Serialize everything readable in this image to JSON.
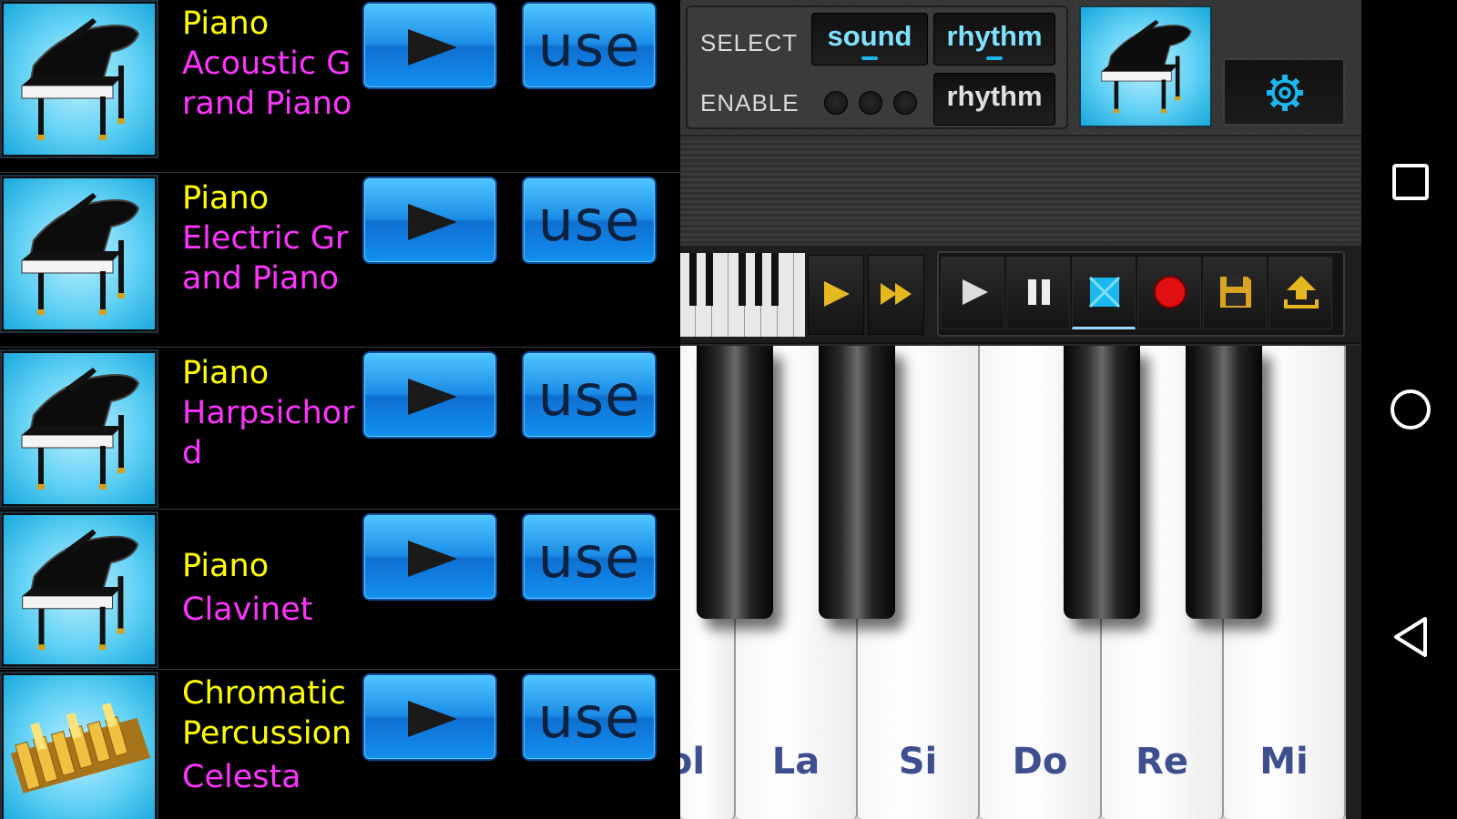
{
  "instrument_list": [
    {
      "category": "Piano",
      "name": "Acoustic Grand Piano",
      "thumb": "grand-piano",
      "use_label": "use"
    },
    {
      "category": "Piano",
      "name": "Electric Grand Piano",
      "thumb": "grand-piano",
      "use_label": "use"
    },
    {
      "category": "Piano",
      "name": "Harpsichord",
      "thumb": "grand-piano",
      "use_label": "use"
    },
    {
      "category": "Piano",
      "name": "Clavinet",
      "thumb": "grand-piano",
      "use_label": "use"
    },
    {
      "category": "Chromatic Percussion",
      "name": "Celesta",
      "thumb": "glockenspiel",
      "use_label": "use"
    }
  ],
  "controls": {
    "select_label": "SELECT",
    "enable_label": "ENABLE",
    "sound_tab": "sound",
    "rhythm_tab": "rhythm",
    "rhythm_enable": "rhythm",
    "settings_icon": "gear-icon"
  },
  "transport": {
    "buttons": [
      "play-next-icon",
      "fast-forward-icon",
      "play-icon",
      "pause-icon",
      "stop-icon",
      "record-icon",
      "save-icon",
      "upload-icon"
    ]
  },
  "keyboard": {
    "white_keys": [
      "ol",
      "La",
      "Si",
      "Do",
      "Re",
      "Mi"
    ]
  },
  "colors": {
    "category_text": "#ffff00",
    "instrument_text": "#ff33ff",
    "button_blue": "#1b8de6",
    "accent_cyan": "#19b7ec",
    "key_label": "#3e4f8f"
  },
  "navbar": {
    "icons": [
      "recents-icon",
      "home-icon",
      "back-icon"
    ]
  }
}
